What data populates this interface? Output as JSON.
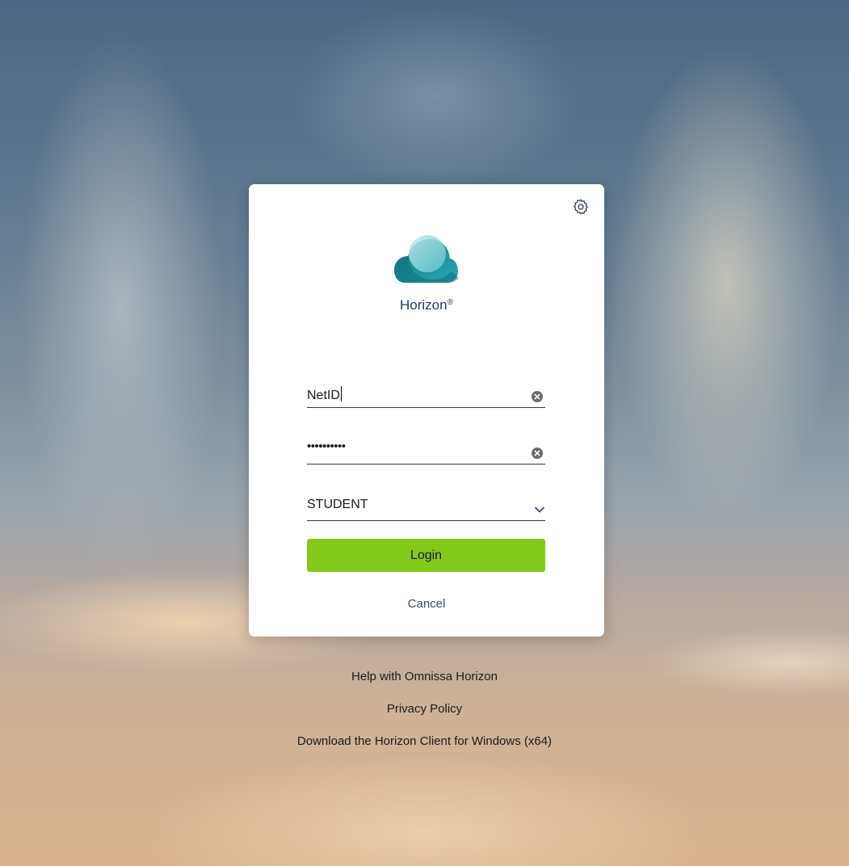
{
  "app": {
    "brand": "Horizon",
    "brand_mark": "®"
  },
  "header": {
    "settings_icon": "gear-icon"
  },
  "form": {
    "username": {
      "value": "NetID"
    },
    "password": {
      "masked_value": "••••••••••"
    },
    "domain": {
      "selected": "STUDENT"
    },
    "login_label": "Login",
    "cancel_label": "Cancel"
  },
  "footer": {
    "links": [
      "Help with Omnissa Horizon",
      "Privacy Policy",
      "Download the Horizon Client for Windows (x64)"
    ]
  },
  "colors": {
    "login_button": "#83c91a",
    "brand_text": "#1f3a5f",
    "logo_teal": "#1a8a93"
  }
}
